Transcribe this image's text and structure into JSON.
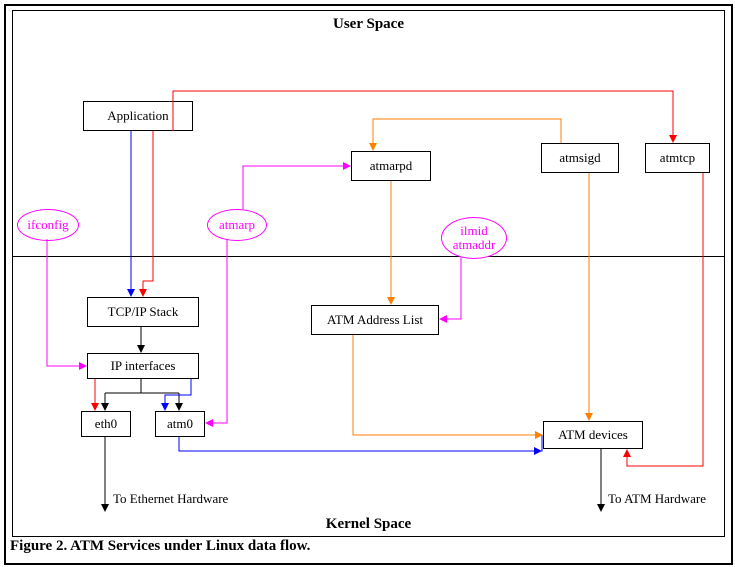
{
  "titles": {
    "user_space": "User Space",
    "kernel_space": "Kernel Space"
  },
  "caption": "Figure 2.  ATM Services under Linux data flow.",
  "boxes": {
    "application": "Application",
    "atmarpd": "atmarpd",
    "atmsigd": "atmsigd",
    "atmtcp": "atmtcp",
    "tcpip": "TCP/IP Stack",
    "atm_addr_list": "ATM Address List",
    "ip_interfaces": "IP interfaces",
    "eth0": "eth0",
    "atm0": "atm0",
    "atm_devices": "ATM devices"
  },
  "ellipses": {
    "ifconfig": "ifconfig",
    "atmarp": "atmarp",
    "ilmid_atmaddr": "ilmid\natmaddr"
  },
  "notes": {
    "to_eth": "To Ethernet Hardware",
    "to_atm": "To ATM Hardware"
  },
  "chart_data": {
    "type": "flow-diagram",
    "regions": [
      {
        "name": "User Space",
        "y_range": "top half"
      },
      {
        "name": "Kernel Space",
        "y_range": "bottom half"
      }
    ],
    "nodes": [
      {
        "id": "application",
        "label": "Application",
        "shape": "rect",
        "region": "User Space"
      },
      {
        "id": "atmarpd",
        "label": "atmarpd",
        "shape": "rect",
        "region": "User Space"
      },
      {
        "id": "atmsigd",
        "label": "atmsigd",
        "shape": "rect",
        "region": "User Space"
      },
      {
        "id": "atmtcp",
        "label": "atmtcp",
        "shape": "rect",
        "region": "User Space"
      },
      {
        "id": "ifconfig",
        "label": "ifconfig",
        "shape": "ellipse",
        "region": "boundary"
      },
      {
        "id": "atmarp",
        "label": "atmarp",
        "shape": "ellipse",
        "region": "boundary"
      },
      {
        "id": "ilmid_atmaddr",
        "label": "ilmid atmaddr",
        "shape": "ellipse",
        "region": "boundary"
      },
      {
        "id": "tcpip",
        "label": "TCP/IP Stack",
        "shape": "rect",
        "region": "Kernel Space"
      },
      {
        "id": "atm_addr_list",
        "label": "ATM Address List",
        "shape": "rect",
        "region": "Kernel Space"
      },
      {
        "id": "ip_interfaces",
        "label": "IP interfaces",
        "shape": "rect",
        "region": "Kernel Space"
      },
      {
        "id": "eth0",
        "label": "eth0",
        "shape": "rect",
        "region": "Kernel Space"
      },
      {
        "id": "atm0",
        "label": "atm0",
        "shape": "rect",
        "region": "Kernel Space"
      },
      {
        "id": "atm_devices",
        "label": "ATM devices",
        "shape": "rect",
        "region": "Kernel Space"
      },
      {
        "id": "eth_hw",
        "label": "To Ethernet Hardware",
        "shape": "exit",
        "region": "Kernel Space"
      },
      {
        "id": "atm_hw",
        "label": "To ATM Hardware",
        "shape": "exit",
        "region": "Kernel Space"
      }
    ],
    "edges": [
      {
        "from": "application",
        "to": "tcpip",
        "color": "blue"
      },
      {
        "from": "application",
        "to": "tcpip",
        "color": "red"
      },
      {
        "from": "application",
        "to": "atm_devices",
        "color": "red",
        "note": "routed across top"
      },
      {
        "from": "tcpip",
        "to": "ip_interfaces",
        "color": "black"
      },
      {
        "from": "ip_interfaces",
        "to": "eth0",
        "color": "black"
      },
      {
        "from": "ip_interfaces",
        "to": "atm0",
        "color": "black"
      },
      {
        "from": "ip_interfaces",
        "to": "eth0",
        "color": "red"
      },
      {
        "from": "ip_interfaces",
        "to": "atm0",
        "color": "blue"
      },
      {
        "from": "eth0",
        "to": "eth_hw",
        "color": "black"
      },
      {
        "from": "atm0",
        "to": "atm_devices",
        "color": "blue"
      },
      {
        "from": "ifconfig",
        "to": "ip_interfaces",
        "color": "magenta"
      },
      {
        "from": "atmarp",
        "to": "atm0",
        "color": "magenta"
      },
      {
        "from": "atmarp",
        "to": "atmarpd",
        "color": "magenta"
      },
      {
        "from": "atmarpd",
        "to": "atm_addr_list",
        "color": "orange"
      },
      {
        "from": "atm_addr_list",
        "to": "atm_devices",
        "color": "orange",
        "note": "consults"
      },
      {
        "from": "ilmid_atmaddr",
        "to": "atm_addr_list",
        "color": "magenta"
      },
      {
        "from": "atmsigd",
        "to": "atm_devices",
        "color": "orange"
      },
      {
        "from": "atmsigd",
        "to": "atmarpd",
        "color": "orange",
        "note": "via top"
      },
      {
        "from": "atmtcp",
        "to": "atm_devices",
        "color": "red"
      },
      {
        "from": "atm_devices",
        "to": "atm_hw",
        "color": "black"
      }
    ]
  }
}
